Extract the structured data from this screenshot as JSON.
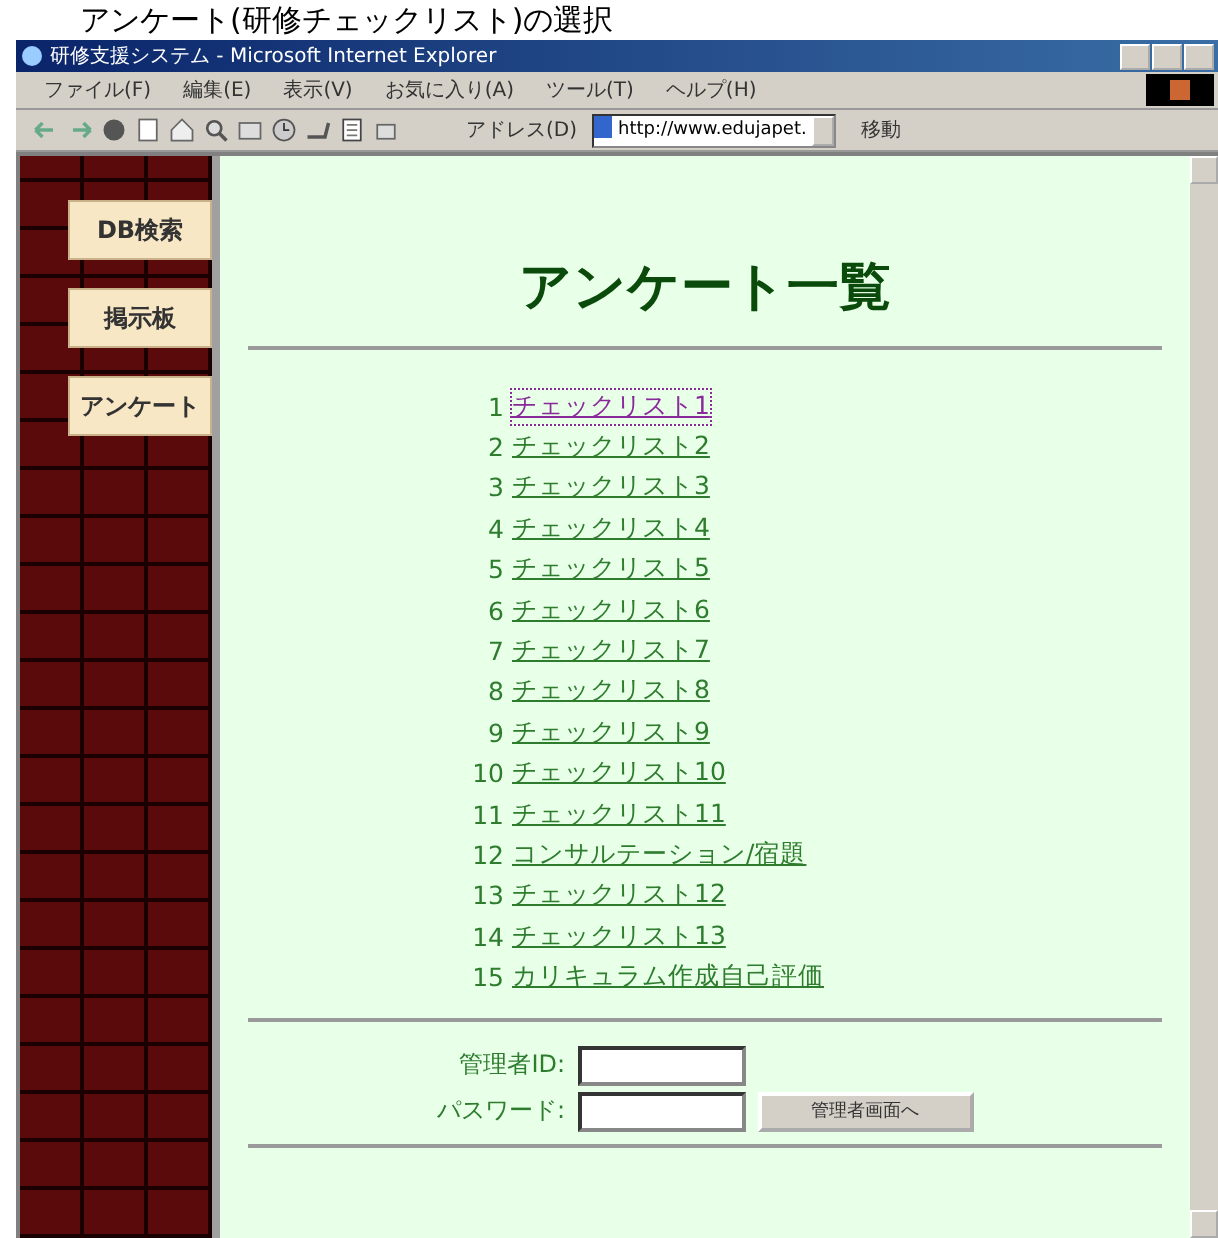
{
  "caption": "アンケート(研修チェックリスト)の選択",
  "window": {
    "title": "研修支援システム - Microsoft Internet Explorer"
  },
  "menu": [
    "ファイル(F)",
    "編集(E)",
    "表示(V)",
    "お気に入り(A)",
    "ツール(T)",
    "ヘルプ(H)"
  ],
  "address": {
    "label": "アドレス(D)",
    "value": "http://www.edujapet.",
    "go": "移動"
  },
  "sidebar": {
    "items": [
      {
        "label": "DB検索"
      },
      {
        "label": "掲示板"
      },
      {
        "label": "アンケート"
      }
    ]
  },
  "heading": "アンケート一覧",
  "surveys": [
    {
      "number": "1",
      "label": "チェックリスト1",
      "visited": true
    },
    {
      "number": "2",
      "label": "チェックリスト2",
      "visited": false
    },
    {
      "number": "3",
      "label": "チェックリスト3",
      "visited": false
    },
    {
      "number": "4",
      "label": "チェックリスト4",
      "visited": false
    },
    {
      "number": "5",
      "label": "チェックリスト5",
      "visited": false
    },
    {
      "number": "6",
      "label": "チェックリスト6",
      "visited": false
    },
    {
      "number": "7",
      "label": "チェックリスト7",
      "visited": false
    },
    {
      "number": "8",
      "label": "チェックリスト8",
      "visited": false
    },
    {
      "number": "9",
      "label": "チェックリスト9",
      "visited": false
    },
    {
      "number": "10",
      "label": "チェックリスト10",
      "visited": false
    },
    {
      "number": "11",
      "label": "チェックリスト11",
      "visited": false
    },
    {
      "number": "12",
      "label": "コンサルテーション/宿題",
      "visited": false
    },
    {
      "number": "13",
      "label": "チェックリスト12",
      "visited": false
    },
    {
      "number": "14",
      "label": "チェックリスト13",
      "visited": false
    },
    {
      "number": "15",
      "label": "カリキュラム作成自己評価",
      "visited": false
    }
  ],
  "login": {
    "id_label": "管理者ID:",
    "password_label": "パスワード:",
    "button": "管理者画面へ"
  }
}
